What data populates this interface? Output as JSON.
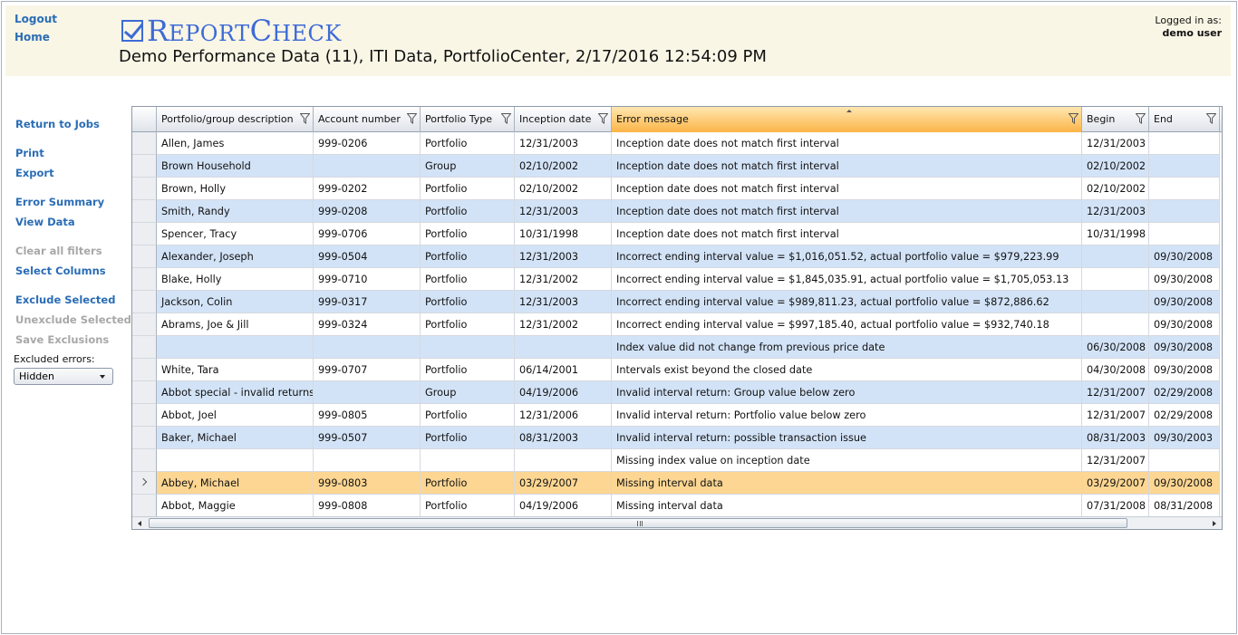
{
  "nav": {
    "logout": "Logout",
    "home": "Home"
  },
  "brand": {
    "logo_r": "R",
    "logo_eport": "EPORT",
    "logo_c": "C",
    "logo_heck": "HECK"
  },
  "report_title": "Demo Performance Data (11), ITI Data, PortfolioCenter, 2/17/2016 12:54:09 PM",
  "user": {
    "label": "Logged in as:",
    "name": "demo user"
  },
  "sidebar": {
    "return_to_jobs": "Return to Jobs",
    "print": "Print",
    "export": "Export",
    "error_summary": "Error Summary",
    "view_data": "View Data",
    "clear_all_filters": "Clear all filters",
    "select_columns": "Select Columns",
    "exclude_selected": "Exclude Selected",
    "unexclude_selected": "Unexclude Selected",
    "save_exclusions": "Save Exclusions",
    "excluded_errors_label": "Excluded errors:",
    "excluded_errors_value": "Hidden"
  },
  "grid": {
    "columns": [
      "Portfolio/group description",
      "Account number",
      "Portfolio Type",
      "Inception date",
      "Error message",
      "Begin",
      "End"
    ],
    "sorted_column": "Error message",
    "selected_row": 15,
    "rows": [
      [
        "Allen, James",
        "999-0206",
        "Portfolio",
        "12/31/2003",
        "Inception date does not match first interval",
        "12/31/2003",
        ""
      ],
      [
        "Brown Household",
        "",
        "Group",
        "02/10/2002",
        "Inception date does not match first interval",
        "02/10/2002",
        ""
      ],
      [
        "Brown, Holly",
        "999-0202",
        "Portfolio",
        "02/10/2002",
        "Inception date does not match first interval",
        "02/10/2002",
        ""
      ],
      [
        "Smith, Randy",
        "999-0208",
        "Portfolio",
        "12/31/2003",
        "Inception date does not match first interval",
        "12/31/2003",
        ""
      ],
      [
        "Spencer, Tracy",
        "999-0706",
        "Portfolio",
        "10/31/1998",
        "Inception date does not match first interval",
        "10/31/1998",
        ""
      ],
      [
        "Alexander, Joseph",
        "999-0504",
        "Portfolio",
        "12/31/2003",
        "Incorrect ending interval value = $1,016,051.52, actual portfolio value = $979,223.99",
        "",
        "09/30/2008"
      ],
      [
        "Blake, Holly",
        "999-0710",
        "Portfolio",
        "12/31/2002",
        "Incorrect ending interval value = $1,845,035.91, actual portfolio value = $1,705,053.13",
        "",
        "09/30/2008"
      ],
      [
        "Jackson, Colin",
        "999-0317",
        "Portfolio",
        "12/31/2003",
        "Incorrect ending interval value = $989,811.23, actual portfolio value = $872,886.62",
        "",
        "09/30/2008"
      ],
      [
        "Abrams, Joe & Jill",
        "999-0324",
        "Portfolio",
        "12/31/2002",
        "Incorrect ending interval value = $997,185.40, actual portfolio value = $932,740.18",
        "",
        "09/30/2008"
      ],
      [
        "",
        "",
        "",
        "",
        "Index value did not change from previous price date",
        "06/30/2008",
        "09/30/2008"
      ],
      [
        "White, Tara",
        "999-0707",
        "Portfolio",
        "06/14/2001",
        "Intervals exist beyond the closed date",
        "04/30/2008",
        "09/30/2008"
      ],
      [
        "Abbot special - invalid returns",
        "",
        "Group",
        "04/19/2006",
        "Invalid interval return: Group value below zero",
        "12/31/2007",
        "02/29/2008"
      ],
      [
        "Abbot, Joel",
        "999-0805",
        "Portfolio",
        "12/31/2006",
        "Invalid interval return: Portfolio value below zero",
        "12/31/2007",
        "02/29/2008"
      ],
      [
        "Baker, Michael",
        "999-0507",
        "Portfolio",
        "08/31/2003",
        "Invalid interval return: possible transaction issue",
        "08/31/2003",
        "09/30/2003"
      ],
      [
        "",
        "",
        "",
        "",
        "Missing index value on inception date",
        "12/31/2007",
        ""
      ],
      [
        "Abbey, Michael",
        "999-0803",
        "Portfolio",
        "03/29/2007",
        "Missing interval data",
        "03/29/2007",
        "09/30/2008"
      ],
      [
        "Abbot, Maggie",
        "999-0808",
        "Portfolio",
        "04/19/2006",
        "Missing interval data",
        "07/31/2008",
        "08/31/2008"
      ]
    ]
  },
  "colors": {
    "link": "#2a6db5",
    "disabled_link": "#a8a8a8",
    "header_bg": "#faf6e6",
    "logo": "#3d6bd6",
    "alt_row": "#d3e3f7",
    "selected_row": "#fcd692",
    "sorted_header": "#fcb448"
  }
}
